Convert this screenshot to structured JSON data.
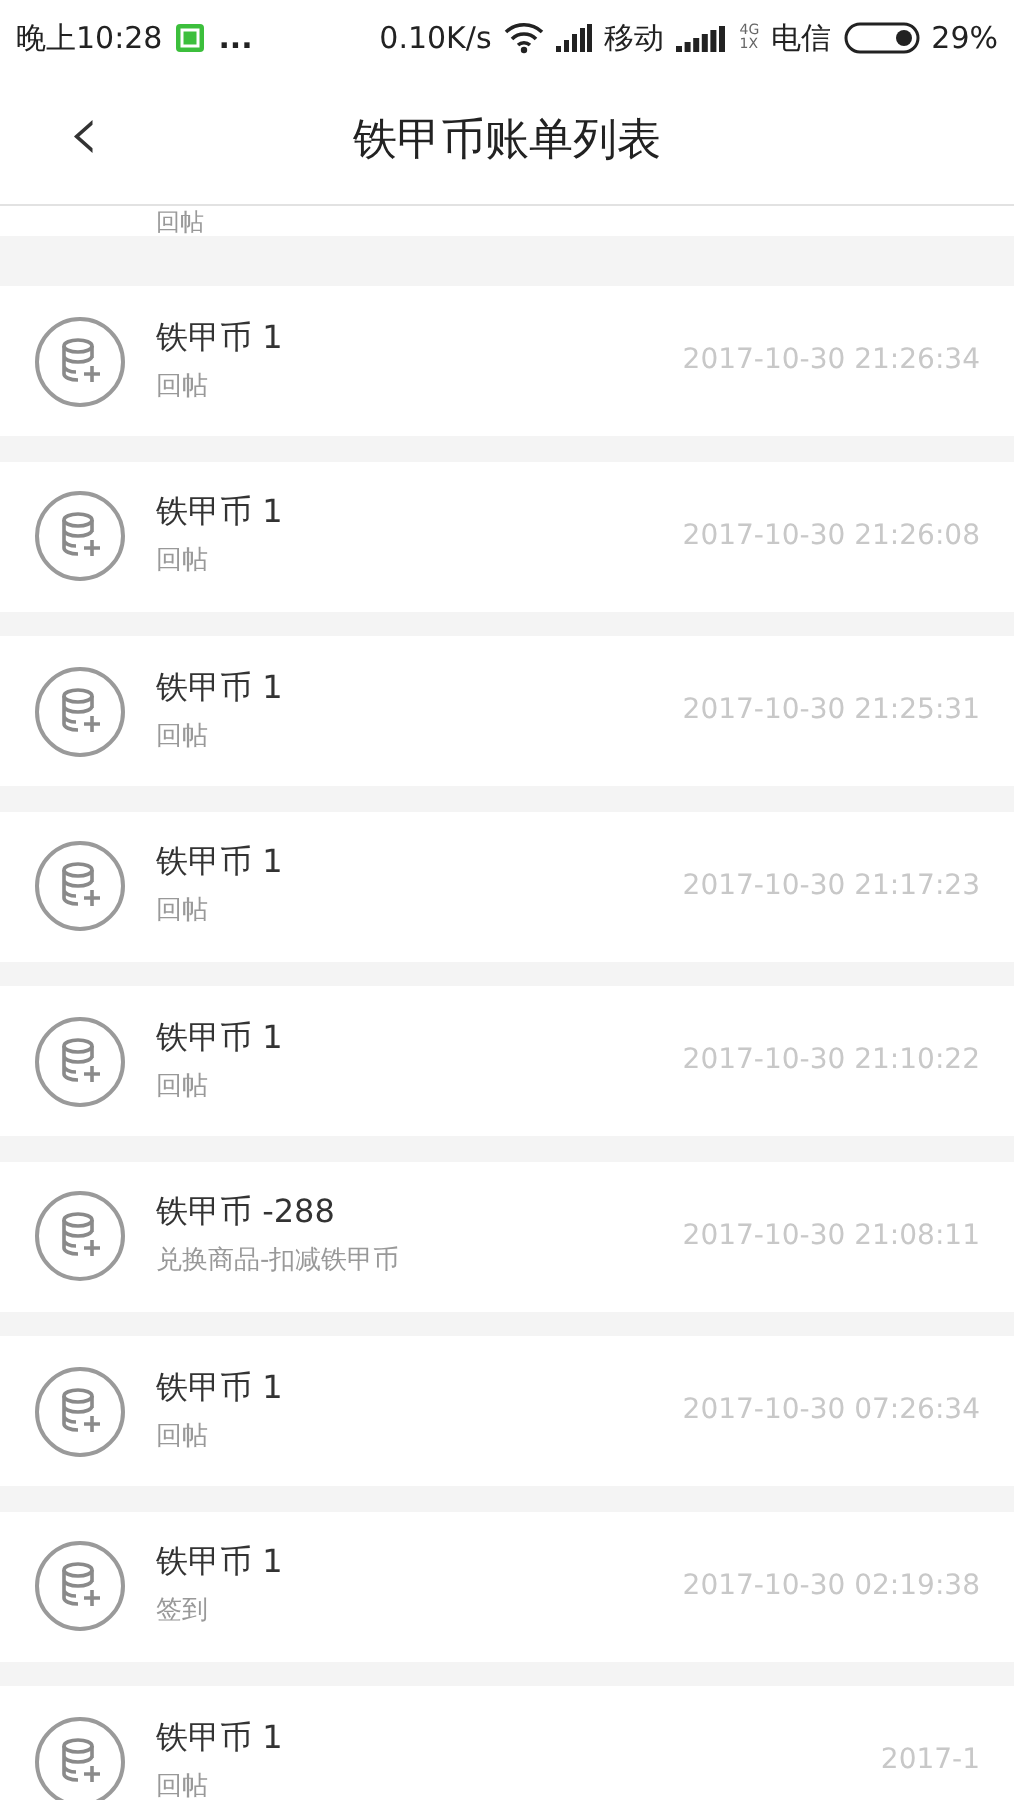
{
  "status_bar": {
    "time": "晚上10:28",
    "more": "...",
    "speed": "0.10K/s",
    "carrier_1": "移动",
    "network_top": "4G",
    "network_bottom": "1X",
    "carrier_2": "电信",
    "battery": "29%"
  },
  "header": {
    "back": "‹",
    "title": "铁甲币账单列表"
  },
  "partial_row": {
    "subtitle": "回帖"
  },
  "rows": [
    {
      "title": "铁甲币 1",
      "subtitle": "回帖",
      "time": "2017-10-30 21:26:34"
    },
    {
      "title": "铁甲币 1",
      "subtitle": "回帖",
      "time": "2017-10-30 21:26:08"
    },
    {
      "title": "铁甲币 1",
      "subtitle": "回帖",
      "time": "2017-10-30 21:25:31"
    },
    {
      "title": "铁甲币 1",
      "subtitle": "回帖",
      "time": "2017-10-30 21:17:23"
    },
    {
      "title": "铁甲币 1",
      "subtitle": "回帖",
      "time": "2017-10-30 21:10:22"
    },
    {
      "title": "铁甲币 -288",
      "subtitle": "兑换商品-扣减铁甲币",
      "time": "2017-10-30 21:08:11"
    },
    {
      "title": "铁甲币 1",
      "subtitle": "回帖",
      "time": "2017-10-30 07:26:34"
    },
    {
      "title": "铁甲币 1",
      "subtitle": "签到",
      "time": "2017-10-30 02:19:38"
    },
    {
      "title": "铁甲币 1",
      "subtitle": "回帖",
      "time": "2017-1"
    }
  ]
}
